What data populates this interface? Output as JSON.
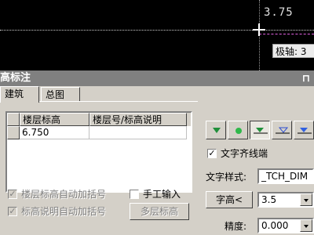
{
  "cad": {
    "top_text": "3.75",
    "tooltip": "极轴: 3"
  },
  "panel": {
    "title": "高标注",
    "pin_icon": "pin-icon",
    "tabs": [
      {
        "label": "建筑",
        "active": true
      },
      {
        "label": "总图",
        "active": false
      }
    ],
    "table": {
      "headers": [
        "楼层标高",
        "楼层号/标高说明"
      ],
      "rows": [
        {
          "elevation": "6.750",
          "note": ""
        }
      ]
    },
    "auto_bracket_floor": {
      "label": "楼层标高自动加括号",
      "checked": true,
      "enabled": false
    },
    "auto_bracket_note": {
      "label": "标高说明自动加括号",
      "checked": true,
      "enabled": false
    },
    "manual_input": {
      "label": "手工输入",
      "checked": false
    },
    "multi_floor_button": "多层标高",
    "symbol_buttons": [
      "triangle-down-filled-icon",
      "circle-filled-icon",
      "triangle-down-with-line-icon",
      "triangle-down-outline-icon",
      "triangle-down-blue-icon"
    ],
    "align_text": {
      "label": "文字齐线端",
      "checked": true
    },
    "text_style": {
      "label": "文字样式:",
      "value": "_TCH_DIM"
    },
    "text_height": {
      "button": "字高<",
      "value": "3.5"
    },
    "precision": {
      "label": "精度:",
      "value": "0.000"
    },
    "colors": {
      "accent_green": "#1f8f3a",
      "title_bg": "#808080",
      "panel_bg": "#d4d0c8"
    }
  }
}
